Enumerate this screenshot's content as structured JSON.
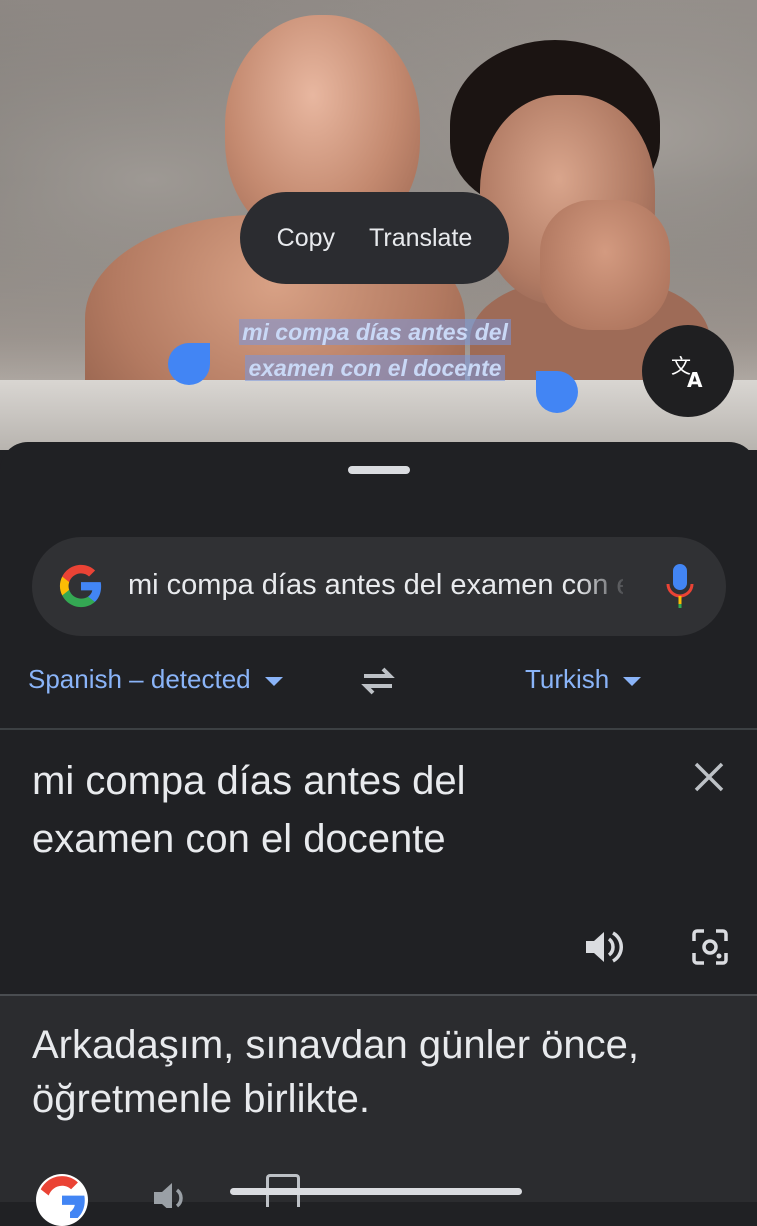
{
  "context_menu": {
    "copy_label": "Copy",
    "translate_label": "Translate"
  },
  "selection": {
    "line1": "mi compa días antes del",
    "line2": "examen con el docente"
  },
  "search": {
    "query": "mi compa días antes del examen con el docente"
  },
  "languages": {
    "source": "Spanish – detected",
    "target": "Turkish"
  },
  "source_text": {
    "line1": "mi compa días antes del",
    "line2": "examen con el docente"
  },
  "translation": {
    "line1": "Arkadaşım, sınavdan günler önce,",
    "line2": "öğretmenle birlikte."
  },
  "colors": {
    "accent": "#8ab4f8",
    "handle": "#4285f4",
    "sheet": "#202124"
  },
  "icons": [
    "translate-icon",
    "google-logo-icon",
    "mic-icon",
    "swap-icon",
    "close-icon",
    "speaker-icon",
    "lens-icon"
  ]
}
